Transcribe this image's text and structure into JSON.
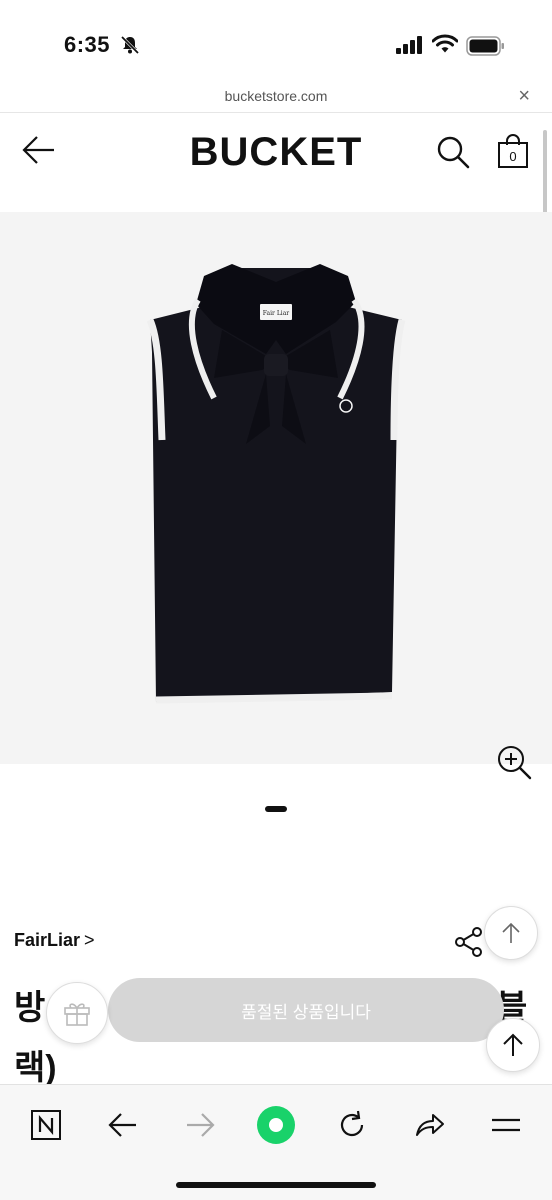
{
  "status_bar": {
    "time": "6:35"
  },
  "browser": {
    "url": "bucketstore.com",
    "close_label": "×"
  },
  "header": {
    "logo": "BUCKET",
    "cart_count": "0"
  },
  "product": {
    "brand": "FairLiar",
    "brand_chevron": ">",
    "title_line1_start": "방",
    "title_line1_end": "블",
    "title_line2": "랙)",
    "label_text": "Fair Liar"
  },
  "actions": {
    "soldout_label": "품절된 상품입니다"
  },
  "colors": {
    "accent": "#19d26a",
    "soldout_bg": "#d6d6d6",
    "image_bg": "#f4f4f4"
  },
  "icons": {
    "status": [
      "bell-slash-icon",
      "signal-icon",
      "wifi-icon",
      "battery-icon"
    ],
    "header": [
      "back-arrow-icon",
      "search-icon",
      "cart-bag-icon"
    ],
    "toolbar": [
      "naver-n-icon",
      "back-icon",
      "forward-icon",
      "green-home-icon",
      "reload-icon",
      "share-icon",
      "menu-icon"
    ]
  }
}
